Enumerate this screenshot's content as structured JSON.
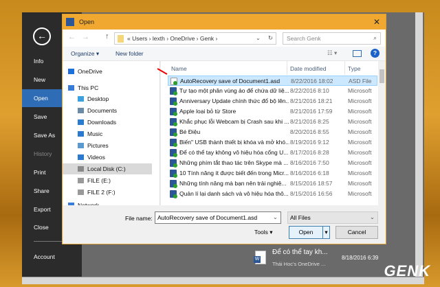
{
  "backstage": {
    "items": [
      "Info",
      "New",
      "Open",
      "Save",
      "Save As",
      "History",
      "Print",
      "Share",
      "Export",
      "Close"
    ],
    "account": "Account",
    "recent": {
      "title": "Để có thể tay kh...",
      "location": "Thái Hoc's OneDrive ...",
      "date": "8/18/2016 6:39"
    }
  },
  "dialog": {
    "title": "Open",
    "breadcrumb": [
      "Users",
      "lexth",
      "OneDrive",
      "Genk"
    ],
    "search_placeholder": "Search Genk",
    "organize": "Organize ▾",
    "new_folder": "New folder",
    "nav": [
      "OneDrive",
      "This PC",
      "Desktop",
      "Documents",
      "Downloads",
      "Music",
      "Pictures",
      "Videos",
      "Local Disk (C:)",
      "FILE (E:)",
      "FILE 2 (F:)",
      "Network"
    ],
    "columns": {
      "name": "Name",
      "date": "Date modified",
      "type": "Type"
    },
    "files": [
      {
        "name": "AutoRecovery save of Document1.asd",
        "date": "8/22/2016 18:02",
        "type": "ASD File"
      },
      {
        "name": "Tự tạo một phân vùng ảo để chứa dữ liệ...",
        "date": "8/22/2016 8:10",
        "type": "Microsoft"
      },
      {
        "name": "Anniversary Update chính thức đổ bộ lên...",
        "date": "8/21/2016 18:21",
        "type": "Microsoft"
      },
      {
        "name": "Apple loại bỏ từ Store",
        "date": "8/21/2016 17:59",
        "type": "Microsoft"
      },
      {
        "name": "Khắc phục lỗi Webcam bị Crash sau khi ...",
        "date": "8/21/2016 8:25",
        "type": "Microsoft"
      },
      {
        "name": "Bé Điệu",
        "date": "8/20/2016 8:55",
        "type": "Microsoft"
      },
      {
        "name": "Biến\" USB thành thiết bị khóa và mở khó...",
        "date": "8/19/2016 9:12",
        "type": "Microsoft"
      },
      {
        "name": "Để có thể tay không vô hiệu hóa cổng U...",
        "date": "8/17/2016 8:28",
        "type": "Microsoft"
      },
      {
        "name": "Những phím tắt thao tác trên Skype mà ...",
        "date": "8/16/2016 7:50",
        "type": "Microsoft"
      },
      {
        "name": "10 Tính năng ít được biết đến trong Micr...",
        "date": "8/16/2016 6:18",
        "type": "Microsoft"
      },
      {
        "name": "Những tính năng mà bạn nên trải nghiệ...",
        "date": "8/15/2016 18:57",
        "type": "Microsoft"
      },
      {
        "name": "Quản lí lại danh sách và vô hiệu hóa thô...",
        "date": "8/15/2016 16:56",
        "type": "Microsoft"
      }
    ],
    "file_name_label": "File name:",
    "file_name_value": "AutoRecovery save of Document1.asd",
    "filter": "All Files",
    "tools": "Tools",
    "open": "Open",
    "cancel": "Cancel"
  },
  "watermark": "GENK"
}
